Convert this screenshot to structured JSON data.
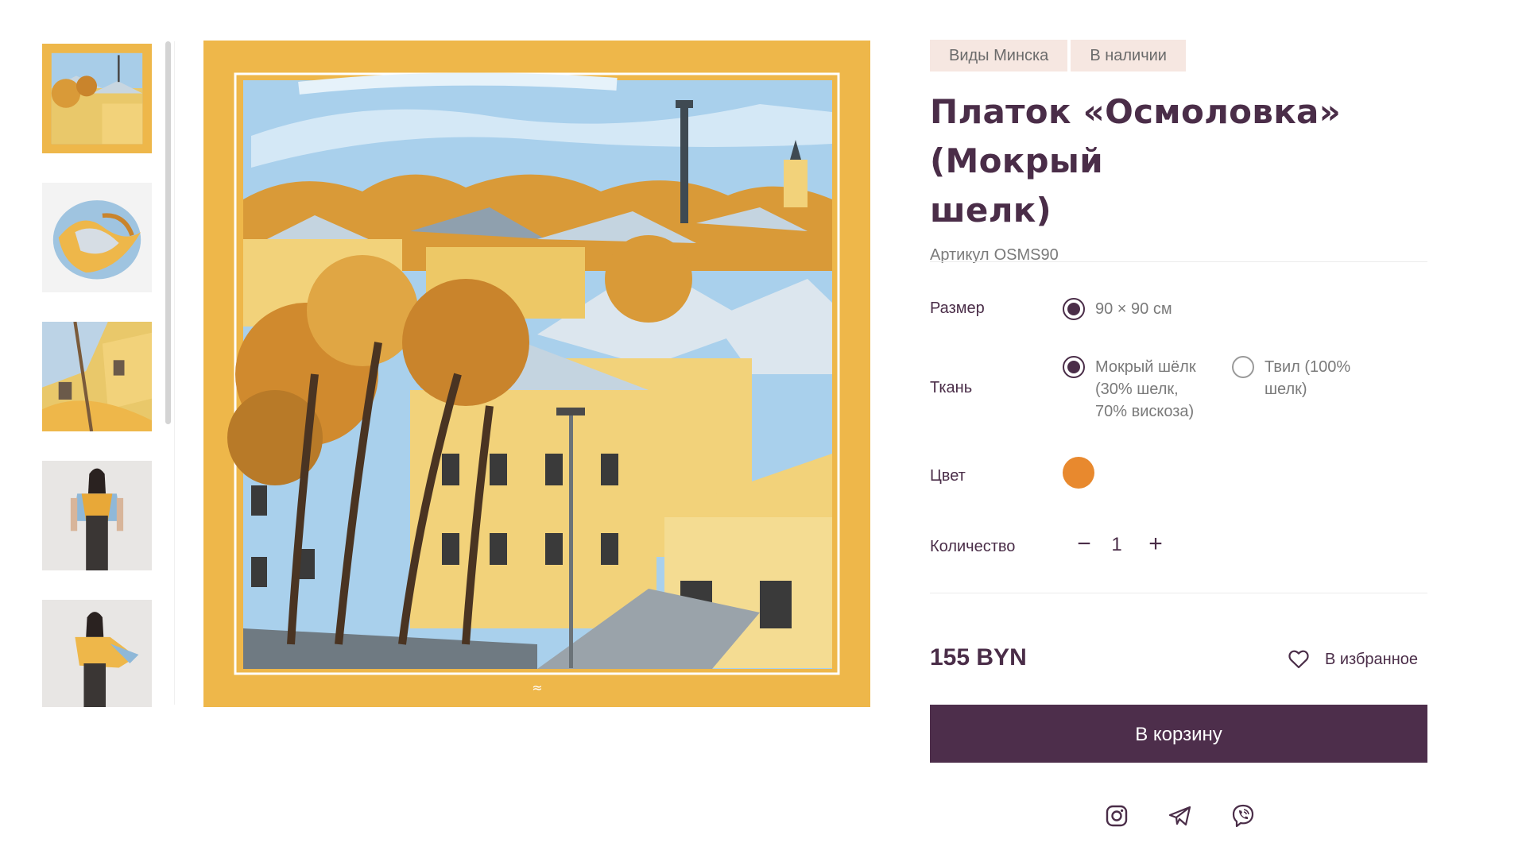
{
  "gallery": {
    "thumbnails": [
      {
        "name": "thumb-scarf-flat",
        "active": true
      },
      {
        "name": "thumb-scarf-draped",
        "active": false
      },
      {
        "name": "thumb-scarf-closeup",
        "active": false
      },
      {
        "name": "thumb-model-front",
        "active": false
      },
      {
        "name": "thumb-model-side",
        "active": false
      }
    ]
  },
  "product": {
    "tags": [
      "Виды Минска",
      "В наличии"
    ],
    "title_line1": "Платок «Осмоловка» (Мокрый",
    "title_line2": "шелк)",
    "sku_label": "Артикул",
    "sku_value": "OSMS90"
  },
  "options": {
    "size": {
      "label": "Размер",
      "choices": [
        {
          "text": "90 × 90 см",
          "selected": true
        }
      ]
    },
    "fabric": {
      "label": "Ткань",
      "choices": [
        {
          "text": "Мокрый шёлк\n(30% шелк,\n70% вискоза)",
          "selected": true
        },
        {
          "text": "Твил (100%\nшелк)",
          "selected": false
        }
      ]
    },
    "color": {
      "label": "Цвет",
      "swatch": "#e8892e",
      "icon": "color-swatch"
    },
    "quantity": {
      "label": "Количество",
      "minus": "−",
      "value": "1",
      "plus": "+"
    }
  },
  "price": "155 BYN",
  "favorite_label": "В избранное",
  "cart_button": "В корзину",
  "social": [
    {
      "name": "instagram-icon"
    },
    {
      "name": "telegram-icon"
    },
    {
      "name": "viber-icon"
    }
  ],
  "colors": {
    "accent": "#4d2e4b",
    "tag_bg": "#f6e7e1",
    "frame": "#eeb74a"
  }
}
